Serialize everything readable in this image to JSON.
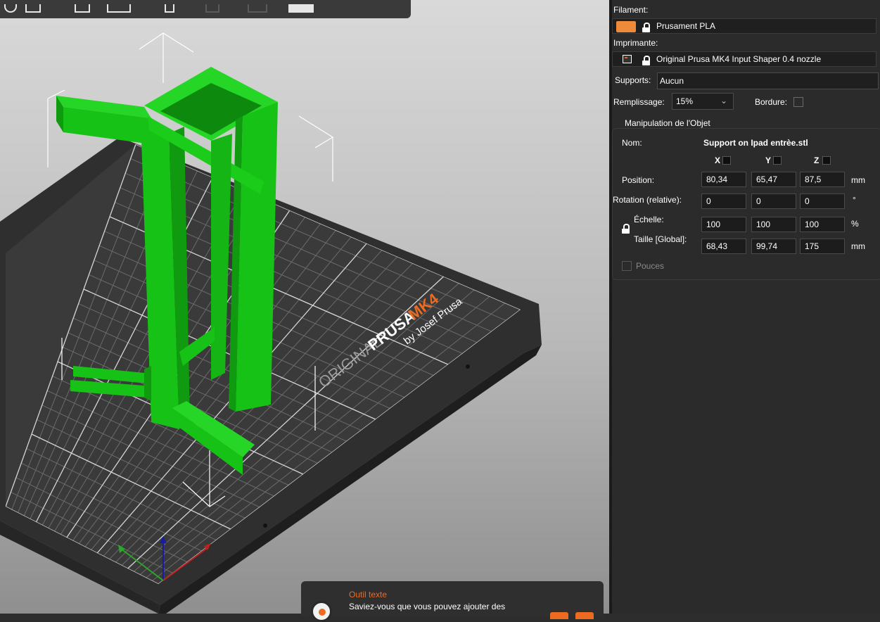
{
  "viewport": {
    "bed_brand_line1": "ORIGINAL",
    "bed_brand_line2": "PRUSA",
    "bed_brand_model": "MK4",
    "bed_brand_sub": "by Josef Prusa",
    "colors": {
      "model": "#17c217",
      "bed": "#3a3a3a",
      "grid": "#dcdcdc",
      "accent": "#ed6b21"
    }
  },
  "tip": {
    "title": "Outil texte",
    "text": "Saviez-vous que vous pouvez ajouter des"
  },
  "panel": {
    "filament": {
      "label": "Filament:",
      "value": "Prusament PLA",
      "swatch_color": "#ed8b3b",
      "icon": "lock-icon"
    },
    "printer": {
      "label": "Imprimante:",
      "value": "Original Prusa MK4 Input Shaper 0.4 nozzle",
      "icon": "printer-icon"
    },
    "supports": {
      "label": "Supports:",
      "value": "Aucun"
    },
    "infill": {
      "label": "Remplissage:",
      "value": "15%"
    },
    "brim": {
      "label": "Bordure:",
      "checked": false
    },
    "manipulation": {
      "title": "Manipulation de l'Objet",
      "name_label": "Nom:",
      "name_value": "Support on Ipad entrèe.stl",
      "axes": [
        "X",
        "Y",
        "Z"
      ],
      "position": {
        "label": "Position:",
        "values": [
          "80,34",
          "65,47",
          "87,5"
        ],
        "unit": "mm"
      },
      "rotation": {
        "label": "Rotation (relative):",
        "values": [
          "0",
          "0",
          "0"
        ],
        "unit": "°"
      },
      "scale": {
        "label": "Échelle:",
        "values": [
          "100",
          "100",
          "100"
        ],
        "unit": "%"
      },
      "size": {
        "label": "Taille [Global]:",
        "values": [
          "68,43",
          "99,74",
          "175"
        ],
        "unit": "mm"
      },
      "inches": {
        "label": "Pouces",
        "checked": false
      }
    }
  }
}
